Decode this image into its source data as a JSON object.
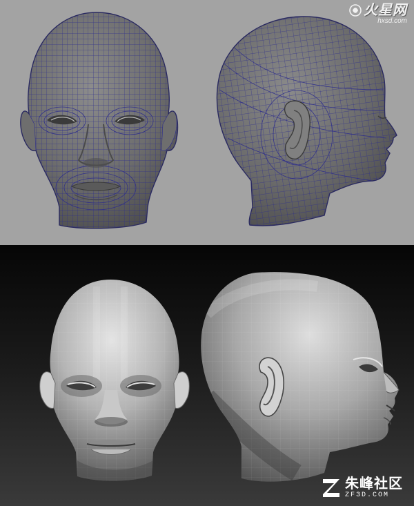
{
  "top_panel": {
    "background": "#a3a3a3",
    "wire_color": "#2c2c8c",
    "views": [
      "front-view",
      "side-view"
    ],
    "watermark": {
      "name": "火星网",
      "url": "hxsd.com"
    }
  },
  "bottom_panel": {
    "background": "#111111",
    "views": [
      "front-view",
      "side-view"
    ],
    "watermark": {
      "name": "朱峰社区",
      "url": "ZF3D.COM"
    }
  }
}
